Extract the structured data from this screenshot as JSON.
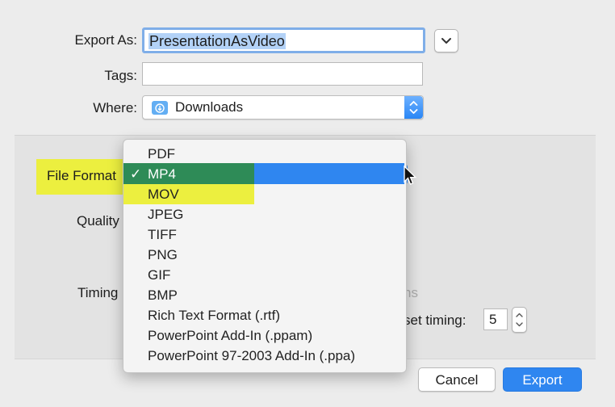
{
  "form": {
    "export_as_label": "Export As:",
    "export_as_value": "PresentationAsVideo",
    "tags_label": "Tags:",
    "tags_value": "",
    "where_label": "Where:",
    "where_value": "Downloads"
  },
  "options": {
    "file_format_label": "File Format",
    "quality_label": "Quality",
    "timing_label": "Timing",
    "timing_fragment": "ns",
    "preset_timing_label": "set timing:",
    "preset_timing_value": "5"
  },
  "file_format_menu": {
    "selected": "MP4",
    "checkmark": "✓",
    "items": [
      "PDF",
      "MP4",
      "MOV",
      "JPEG",
      "TIFF",
      "PNG",
      "GIF",
      "BMP",
      "Rich Text Format (.rtf)",
      "PowerPoint Add-In (.ppam)",
      "PowerPoint 97-2003 Add-In (.ppa)"
    ]
  },
  "buttons": {
    "cancel": "Cancel",
    "export": "Export"
  },
  "colors": {
    "accent": "#2f86f0",
    "selected_item": "#2e8b57",
    "annotation_highlight": "#ecef3f"
  },
  "icons": {
    "expand": "chevron-down-icon",
    "where_folder": "downloads-folder-icon",
    "cursor": "mouse-pointer-icon"
  }
}
